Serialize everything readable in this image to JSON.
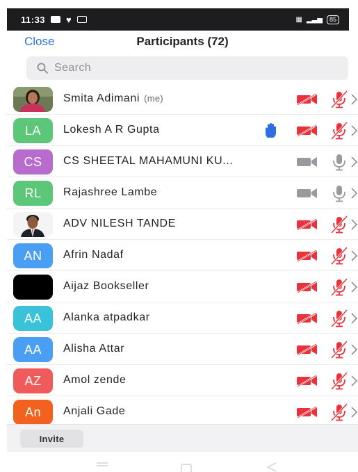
{
  "status_bar": {
    "time": "11:33",
    "battery": "85"
  },
  "header": {
    "close_label": "Close",
    "title": "Participants (72)"
  },
  "search": {
    "placeholder": "Search"
  },
  "participants": [
    {
      "initials": "",
      "name": "Smita Adimani",
      "suffix": "(me)",
      "avatar": "photo-woman",
      "hand_raised": false,
      "video": "off",
      "audio": "muted"
    },
    {
      "initials": "LA",
      "name": "Lokesh A R Gupta",
      "suffix": "",
      "avatar_color": "#5cc679",
      "hand_raised": true,
      "video": "off",
      "audio": "muted"
    },
    {
      "initials": "CS",
      "name": "CS SHEETAL MAHAMUNI KU...",
      "suffix": "",
      "avatar_color": "#b86ccd",
      "hand_raised": false,
      "video": "no-permission",
      "audio": "no-audio"
    },
    {
      "initials": "RL",
      "name": "Rajashree Lambe",
      "suffix": "",
      "avatar_color": "#5cc679",
      "hand_raised": false,
      "video": "no-permission",
      "audio": "no-audio"
    },
    {
      "initials": "",
      "name": "ADV NILESH TANDE",
      "suffix": "",
      "avatar": "photo-man",
      "hand_raised": false,
      "video": "off",
      "audio": "muted"
    },
    {
      "initials": "AN",
      "name": "Afrin Nadaf",
      "suffix": "",
      "avatar_color": "#4b9ff2",
      "hand_raised": false,
      "video": "off",
      "audio": "muted"
    },
    {
      "initials": "",
      "name": "Aijaz Bookseller",
      "suffix": "",
      "avatar": "black",
      "hand_raised": false,
      "video": "off",
      "audio": "muted"
    },
    {
      "initials": "AA",
      "name": "Alanka atpadkar",
      "suffix": "",
      "avatar_color": "#3ac2d9",
      "hand_raised": false,
      "video": "off",
      "audio": "muted"
    },
    {
      "initials": "AA",
      "name": "Alisha Attar",
      "suffix": "",
      "avatar_color": "#4b9ff2",
      "hand_raised": false,
      "video": "off",
      "audio": "muted"
    },
    {
      "initials": "AZ",
      "name": "Amol zende",
      "suffix": "",
      "avatar_color": "#ef5b5b",
      "hand_raised": false,
      "video": "off",
      "audio": "muted"
    },
    {
      "initials": "An",
      "name": "Anjali Gade",
      "suffix": "",
      "avatar_color": "#f2611e",
      "hand_raised": false,
      "video": "off",
      "audio": "muted"
    }
  ],
  "footer": {
    "invite_label": "Invite"
  },
  "icons": {
    "muted_color": "#e8323c",
    "inactive_color": "#9a9a9e",
    "hand_color": "#2d6fe0",
    "link_color": "#2b75d8"
  }
}
